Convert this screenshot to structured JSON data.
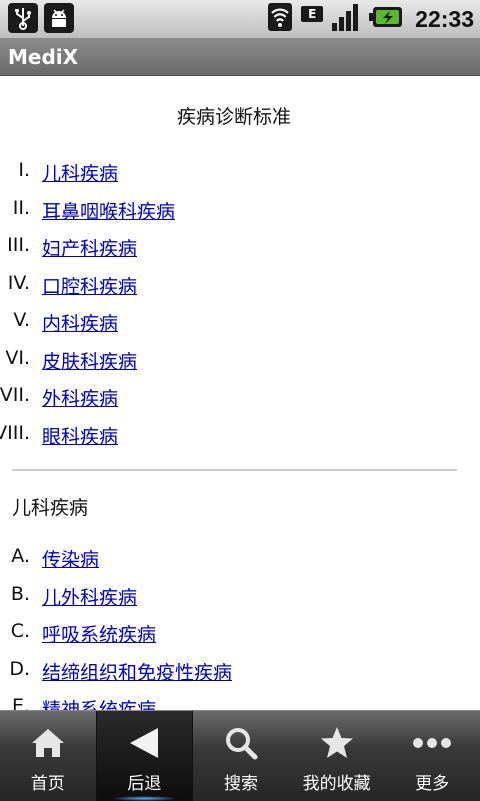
{
  "status_bar": {
    "time": "22:33",
    "network_badge": "E",
    "icons": [
      "usb-icon",
      "android-debug-icon",
      "wifi-icon",
      "signal-icon",
      "battery-charging-icon"
    ]
  },
  "app": {
    "title": "MediX"
  },
  "page": {
    "title": "疾病诊断标准",
    "index": [
      {
        "num": "I.",
        "label": "儿科疾病"
      },
      {
        "num": "II.",
        "label": "耳鼻咽喉科疾病"
      },
      {
        "num": "III.",
        "label": "妇产科疾病"
      },
      {
        "num": "IV.",
        "label": "口腔科疾病"
      },
      {
        "num": "V.",
        "label": "内科疾病"
      },
      {
        "num": "VI.",
        "label": "皮肤科疾病"
      },
      {
        "num": "VII.",
        "label": "外科疾病"
      },
      {
        "num": "VIII.",
        "label": "眼科疾病"
      }
    ],
    "section": {
      "title": "儿科疾病",
      "items": [
        {
          "num": "A.",
          "label": "传染病"
        },
        {
          "num": "B.",
          "label": "儿外科疾病"
        },
        {
          "num": "C.",
          "label": "呼吸系统疾病"
        },
        {
          "num": "D.",
          "label": "结缔组织和免疫性疾病"
        },
        {
          "num": "E.",
          "label": "精神系统疾病"
        }
      ]
    }
  },
  "bottom_nav": [
    {
      "label": "首页",
      "icon": "home-icon"
    },
    {
      "label": "后退",
      "icon": "back-arrow-icon",
      "active": true
    },
    {
      "label": "搜索",
      "icon": "search-icon"
    },
    {
      "label": "我的收藏",
      "icon": "star-icon"
    },
    {
      "label": "更多",
      "icon": "more-dots-icon"
    }
  ],
  "colors": {
    "link": "#0000cc",
    "title_bar": "#7a7a7a",
    "active_glow": "#5ab0ff"
  }
}
